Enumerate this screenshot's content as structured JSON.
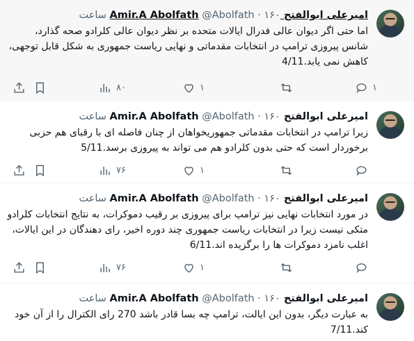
{
  "tweets": [
    {
      "author_name": "امیرعلی ابوالفتح Amir.A Abolfath",
      "handle": "@Abolfath",
      "time": "۱۶۰ ساعت",
      "text": "اما حتی اگر دیوان عالی فدرال ایالات متحده بر نظر دیوان عالی کلرادو صحه گذارد، شانس پیروزی ترامپ در انتخابات مقدماتی و نهایی ریاست جمهوری به شکل قابل توجهی، کاهش نمی یابد.4/11",
      "replies": "۱",
      "retweets": "",
      "likes": "۱",
      "views": "۸۰"
    },
    {
      "author_name": "امیرعلی ابوالفتح Amir.A Abolfath",
      "handle": "@Abolfath",
      "time": "۱۶۰ ساعت",
      "text": "زیرا ترامپ در انتخابات مقدماتی جمهوریخواهان از چنان فاصله ای با رقبای هم حزبی برخوردار است که حتی بدون کلرادو هم می تواند به پیروزی برسد.5/11",
      "replies": "",
      "retweets": "",
      "likes": "۱",
      "views": "۷۶"
    },
    {
      "author_name": "امیرعلی ابوالفتح Amir.A Abolfath",
      "handle": "@Abolfath",
      "time": "۱۶۰ ساعت",
      "text": "در مورد انتخابات نهایی نیز ترامپ برای پیروزی بر رقیب دموکرات، به نتایج انتخابات کلرادو متکی نیست زیرا در انتخابات ریاست جمهوری چند دوره اخیر، رای دهندگان در این ایالات، اغلب نامزد دموکرات ها را برگزیده اند.6/11",
      "replies": "",
      "retweets": "",
      "likes": "۱",
      "views": "۷۶"
    },
    {
      "author_name": "امیرعلی ابوالفتح Amir.A Abolfath",
      "handle": "@Abolfath",
      "time": "۱۶۰ ساعت",
      "text": "به عبارت دیگر، بدون این ایالت، ترامپ چه بسا قادر باشد 270 رای الکترال را از آن خود کند.7/11",
      "replies": "",
      "retweets": "",
      "likes": "",
      "views": ""
    }
  ],
  "icons": {
    "reply": "reply-icon",
    "retweet": "retweet-icon",
    "like": "heart-icon",
    "views": "views-icon",
    "bookmark": "bookmark-icon",
    "share": "share-icon"
  }
}
